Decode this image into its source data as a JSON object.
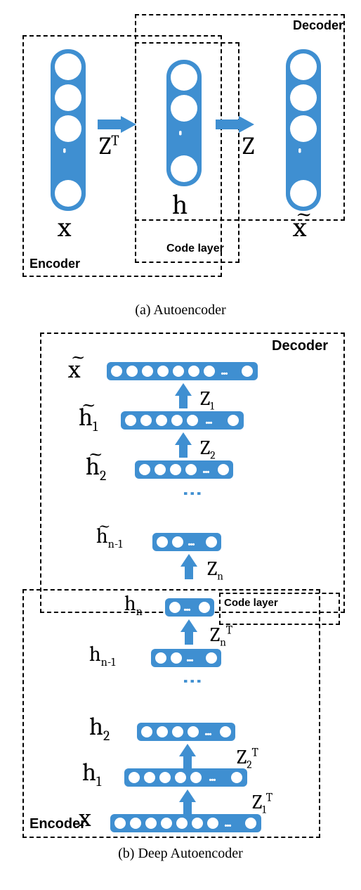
{
  "caption_a": "(a) Autoencoder",
  "caption_b": "(b) Deep Autoencoder",
  "labels": {
    "encoder": "Encoder",
    "decoder": "Decoder",
    "code_layer": "Code layer"
  },
  "panel_a": {
    "x": "x",
    "h": "h",
    "xt": "x",
    "ZT": "Z",
    "ZT_sup": "T",
    "Z": "Z"
  },
  "panel_b": {
    "layers_decoder": [
      {
        "left": "x",
        "left_tilde": true,
        "right": "",
        "right_sub": ""
      },
      {
        "left": "h",
        "left_tilde": true,
        "left_sub": "1",
        "right": "Z",
        "right_sub": "1"
      },
      {
        "left": "h",
        "left_tilde": true,
        "left_sub": "2",
        "right": "Z",
        "right_sub": "2"
      },
      {
        "left": "h",
        "left_tilde": true,
        "left_sub": "n-1",
        "right": "Z",
        "right_sub": "n"
      }
    ],
    "code": {
      "left": "h",
      "left_sub": "n",
      "label": "Code layer"
    },
    "layers_encoder": [
      {
        "left": "h",
        "left_sub": "n-1",
        "right": "Z",
        "right_sub": "n",
        "right_sup": "T"
      },
      {
        "left": "h",
        "left_sub": "2",
        "right": "",
        "right_sub": ""
      },
      {
        "left": "h",
        "left_sub": "1",
        "right": "Z",
        "right_sub": "2",
        "right_sup": "T"
      },
      {
        "left": "x",
        "left_sub": "",
        "right": "Z",
        "right_sub": "1",
        "right_sup": "T"
      }
    ]
  },
  "chart_data": {
    "type": "diagram",
    "subfigures": [
      {
        "id": "a",
        "title": "Autoencoder",
        "boxes": [
          "Encoder",
          "Code layer",
          "Decoder"
        ],
        "nodes": [
          "x",
          "h",
          "x_tilde"
        ],
        "edges": [
          {
            "from": "x",
            "to": "h",
            "label": "Z^T"
          },
          {
            "from": "h",
            "to": "x_tilde",
            "label": "Z"
          }
        ]
      },
      {
        "id": "b",
        "title": "Deep Autoencoder",
        "boxes": [
          "Encoder",
          "Code layer",
          "Decoder"
        ],
        "encoder_path": [
          {
            "layer": "x"
          },
          {
            "layer": "h_1",
            "weight": "Z_1^T"
          },
          {
            "layer": "h_2",
            "weight": "Z_2^T"
          },
          {
            "layer": "...",
            "weight": "..."
          },
          {
            "layer": "h_{n-1}",
            "weight": "Z_n^T"
          },
          {
            "layer": "h_n"
          }
        ],
        "decoder_path": [
          {
            "layer": "h_n"
          },
          {
            "layer": "h_tilde_{n-1}",
            "weight": "Z_n"
          },
          {
            "layer": "...",
            "weight": "..."
          },
          {
            "layer": "h_tilde_2",
            "weight": "Z_2"
          },
          {
            "layer": "h_tilde_1",
            "weight": "Z_1"
          },
          {
            "layer": "x_tilde"
          }
        ],
        "tied_weights": true
      }
    ]
  }
}
